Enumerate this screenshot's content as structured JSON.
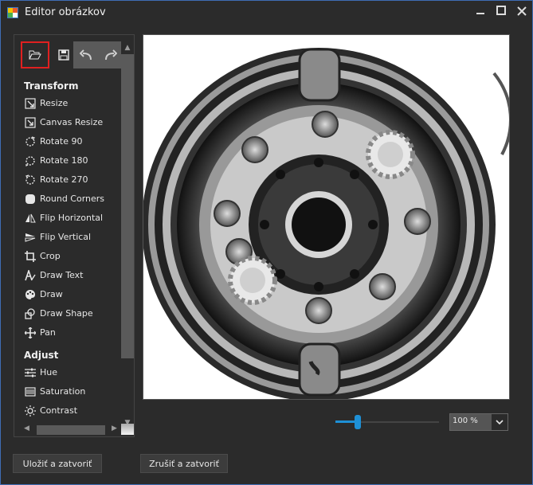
{
  "window": {
    "title": "Editor obrázkov"
  },
  "toolbar": {
    "open_icon": "folder-open-icon",
    "save_icon": "floppy-disk-icon",
    "undo_icon": "undo-arrow-icon",
    "redo_icon": "redo-arrow-icon"
  },
  "sidebar": {
    "transform": {
      "label": "Transform",
      "items": [
        {
          "label": "Resize",
          "icon": "resize-icon"
        },
        {
          "label": "Canvas Resize",
          "icon": "canvas-resize-icon"
        },
        {
          "label": "Rotate 90",
          "icon": "rotate-90-icon"
        },
        {
          "label": "Rotate 180",
          "icon": "rotate-180-icon"
        },
        {
          "label": "Rotate 270",
          "icon": "rotate-270-icon"
        },
        {
          "label": "Round Corners",
          "icon": "round-corners-icon"
        },
        {
          "label": "Flip Horizontal",
          "icon": "flip-horizontal-icon"
        },
        {
          "label": "Flip Vertical",
          "icon": "flip-vertical-icon"
        },
        {
          "label": "Crop",
          "icon": "crop-icon"
        },
        {
          "label": "Draw Text",
          "icon": "draw-text-icon"
        },
        {
          "label": "Draw",
          "icon": "palette-icon"
        },
        {
          "label": "Draw Shape",
          "icon": "draw-shape-icon"
        },
        {
          "label": "Pan",
          "icon": "pan-icon"
        }
      ]
    },
    "adjust": {
      "label": "Adjust",
      "items": [
        {
          "label": "Hue",
          "icon": "hue-sliders-icon"
        },
        {
          "label": "Saturation",
          "icon": "saturation-icon"
        },
        {
          "label": "Contrast",
          "icon": "contrast-sun-icon"
        }
      ]
    }
  },
  "zoom": {
    "value": "100 %",
    "slider_fraction": 0.2
  },
  "footer": {
    "save_label": "Uložiť a zatvoriť",
    "cancel_label": "Zrušiť a zatvoriť"
  },
  "colors": {
    "accent": "#1e90d6",
    "highlight": "#e02020",
    "window_border": "#3f6db5"
  }
}
